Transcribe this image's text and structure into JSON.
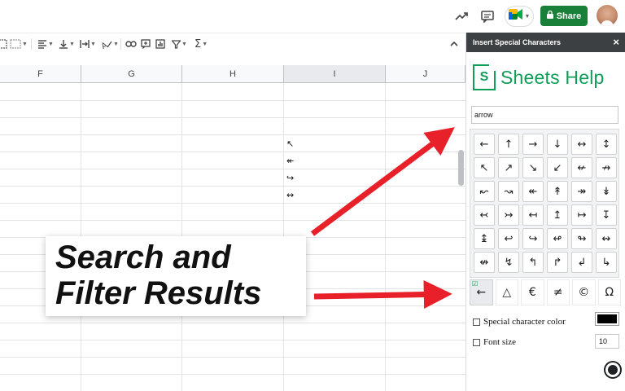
{
  "topbar": {
    "share_label": "Share",
    "icons": [
      "trend-arrow-icon",
      "comment-icon",
      "meet-icon",
      "lock-icon",
      "avatar"
    ]
  },
  "toolbar": {
    "sigma_label": "Σ",
    "icons": [
      "borders-icon",
      "merge-icon",
      "h-align-icon",
      "v-align-icon",
      "wrap-icon",
      "rotate-icon",
      "link-icon",
      "comment-add-icon",
      "chart-icon",
      "filter-icon",
      "functions-icon",
      "collapse-icon"
    ]
  },
  "grid": {
    "columns": [
      {
        "label": "F",
        "selected": false
      },
      {
        "label": "G",
        "selected": false
      },
      {
        "label": "H",
        "selected": false
      },
      {
        "label": "I",
        "selected": true
      },
      {
        "label": "J",
        "selected": false
      }
    ],
    "cells": [
      "↖",
      "↞",
      "↪",
      "↭"
    ]
  },
  "callout": {
    "line1": "Search and",
    "line2": "Filter Results"
  },
  "sidebar": {
    "title": "Insert Special Characters",
    "close": "×",
    "logo_letter": "S",
    "logo_text": "Sheets Help",
    "search_value": "arrow",
    "characters": [
      "←",
      "↑",
      "→",
      "↓",
      "↔",
      "↕",
      "↖",
      "↗",
      "↘",
      "↙",
      "↚",
      "↛",
      "↜",
      "↝",
      "↞",
      "↟",
      "↠",
      "↡",
      "↢",
      "↣",
      "↤",
      "↥",
      "↦",
      "↧",
      "↨",
      "↩",
      "↪",
      "↫",
      "↬",
      "↭",
      "↮",
      "↯",
      "↰",
      "↱",
      "↲",
      "↳"
    ],
    "categories": [
      {
        "symbol": "←",
        "selected": true
      },
      {
        "symbol": "△",
        "selected": false
      },
      {
        "symbol": "€",
        "selected": false
      },
      {
        "symbol": "≠",
        "selected": false
      },
      {
        "symbol": "©",
        "selected": false
      },
      {
        "symbol": "Ω",
        "selected": false
      }
    ],
    "selected_check": "☑",
    "color_label": "Special character color",
    "color_value": "#000000",
    "font_size_label": "Font size",
    "font_size_value": "10"
  },
  "colors": {
    "share_green": "#188038",
    "logo_green": "#0f9d58",
    "arrow_red": "#e8202a",
    "sidebar_header": "#3c4043"
  }
}
